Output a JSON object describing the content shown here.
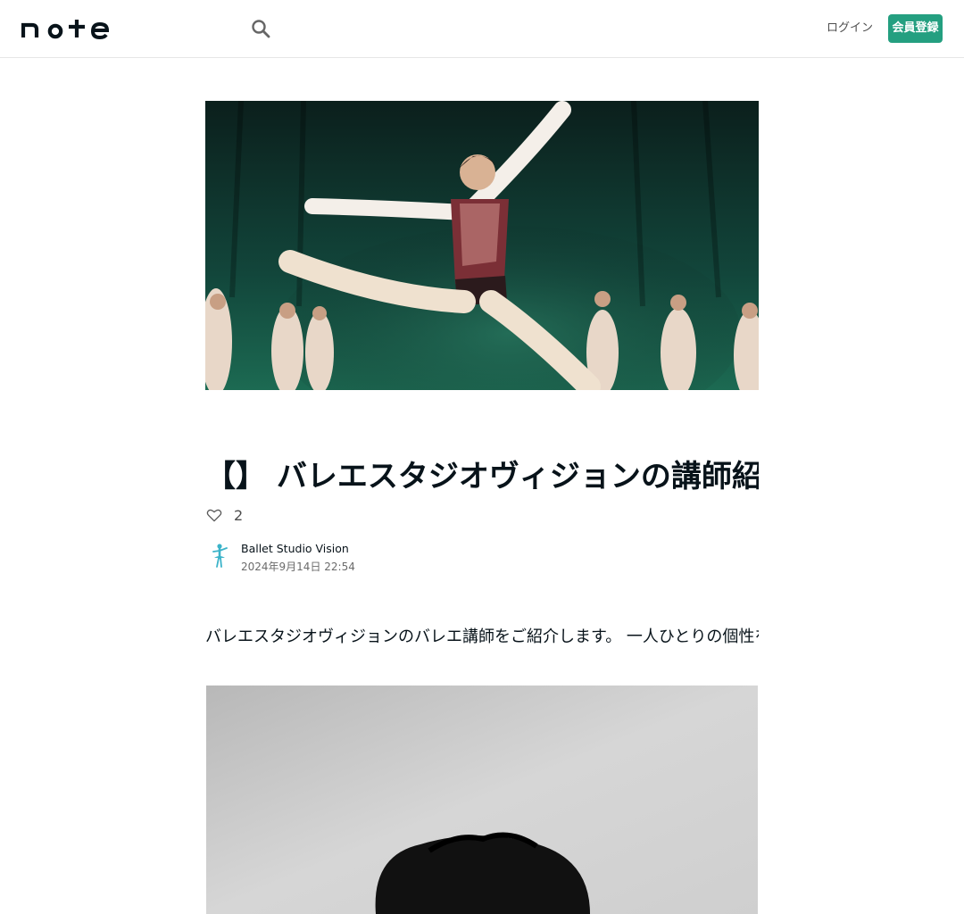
{
  "header": {
    "logo_text": "note",
    "search_icon": "search-icon",
    "login_label": "ログイン",
    "signup_label": "会員登録",
    "accent_color": "#249f80"
  },
  "article": {
    "title": "【】 バレエスタジオヴィジョンの講師紹介について",
    "like_count": "2",
    "author_name": "Ballet Studio Vision",
    "post_date": "2024年9月14日 22:54",
    "body_first_paragraph": "バレエスタジオヴィジョンのバレエ講師をご紹介します。 一人ひとりの個性を大切にした丁寧な指導を行っています。"
  }
}
